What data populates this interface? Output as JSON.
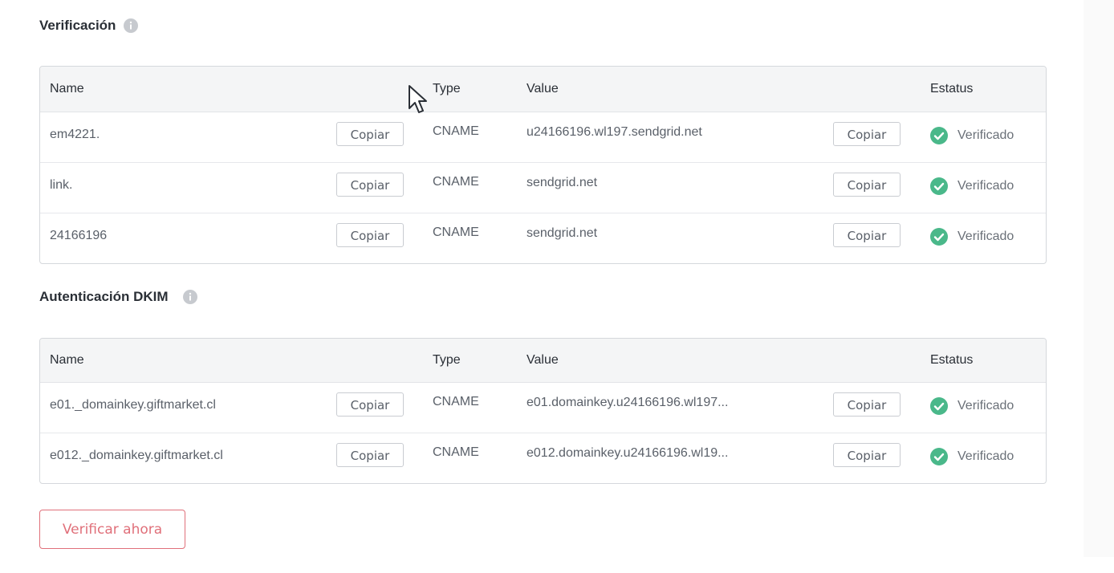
{
  "colors": {
    "verified_green": "#4ab88a",
    "accent_red": "#e0707a",
    "header_bg": "#f4f5f6",
    "border": "#d5d8dc"
  },
  "icons": {
    "info": "info-icon",
    "verified": "check-circle-icon",
    "cursor": "mouse-cursor-icon"
  },
  "verification": {
    "title": "Verificación",
    "columns": {
      "name": "Name",
      "type": "Type",
      "value": "Value",
      "status": "Estatus"
    },
    "rows": [
      {
        "name": "em4221.",
        "copy_label": "Copiar",
        "type": "CNAME",
        "value": "u24166196.wl197.sendgrid.net",
        "status": "Verificado"
      },
      {
        "name": "link.",
        "copy_label": "Copiar",
        "type": "CNAME",
        "value": "sendgrid.net",
        "status": "Verificado"
      },
      {
        "name": "24166196",
        "copy_label": "Copiar",
        "type": "CNAME",
        "value": "sendgrid.net",
        "status": "Verificado"
      }
    ]
  },
  "dkim": {
    "title": "Autenticación DKIM",
    "columns": {
      "name": "Name",
      "type": "Type",
      "value": "Value",
      "status": "Estatus"
    },
    "rows": [
      {
        "name": "e01._domainkey.giftmarket.cl",
        "copy_label": "Copiar",
        "type": "CNAME",
        "value": "e01.domainkey.u24166196.wl197...",
        "status": "Verificado"
      },
      {
        "name": "e012._domainkey.giftmarket.cl",
        "copy_label": "Copiar",
        "type": "CNAME",
        "value": "e012.domainkey.u24166196.wl19...",
        "status": "Verificado"
      }
    ]
  },
  "actions": {
    "verify_now": "Verificar ahora"
  }
}
